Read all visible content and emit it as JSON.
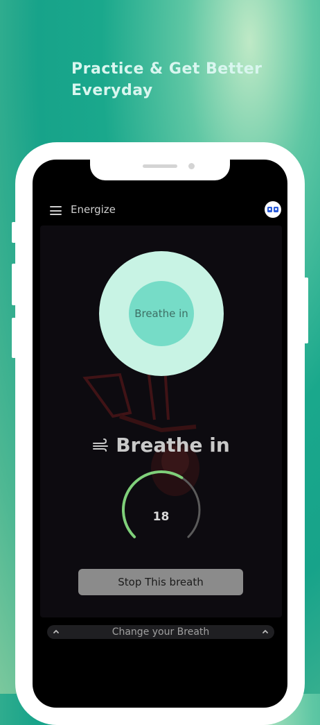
{
  "promo": {
    "headline": "Practice & Get Better Everyday"
  },
  "appbar": {
    "title": "Energize",
    "menu_icon": "hamburger-menu-icon",
    "avatar_icon": "profile-avatar-icon"
  },
  "breath": {
    "circle_label": "Breathe in",
    "phase_label": "Breathe in",
    "phase_icon": "wind-icon",
    "timer_value": "18",
    "timer_progress": 0.62
  },
  "actions": {
    "stop_label": "Stop This breath"
  },
  "bottom_sheet": {
    "label": "Change your Breath",
    "icon": "chevron-up-icon"
  },
  "colors": {
    "outer_circle": "#c8f3e4",
    "inner_circle": "#76dcc7",
    "timer_arc": "#7fd07a",
    "background_teal": "#17a38a"
  }
}
